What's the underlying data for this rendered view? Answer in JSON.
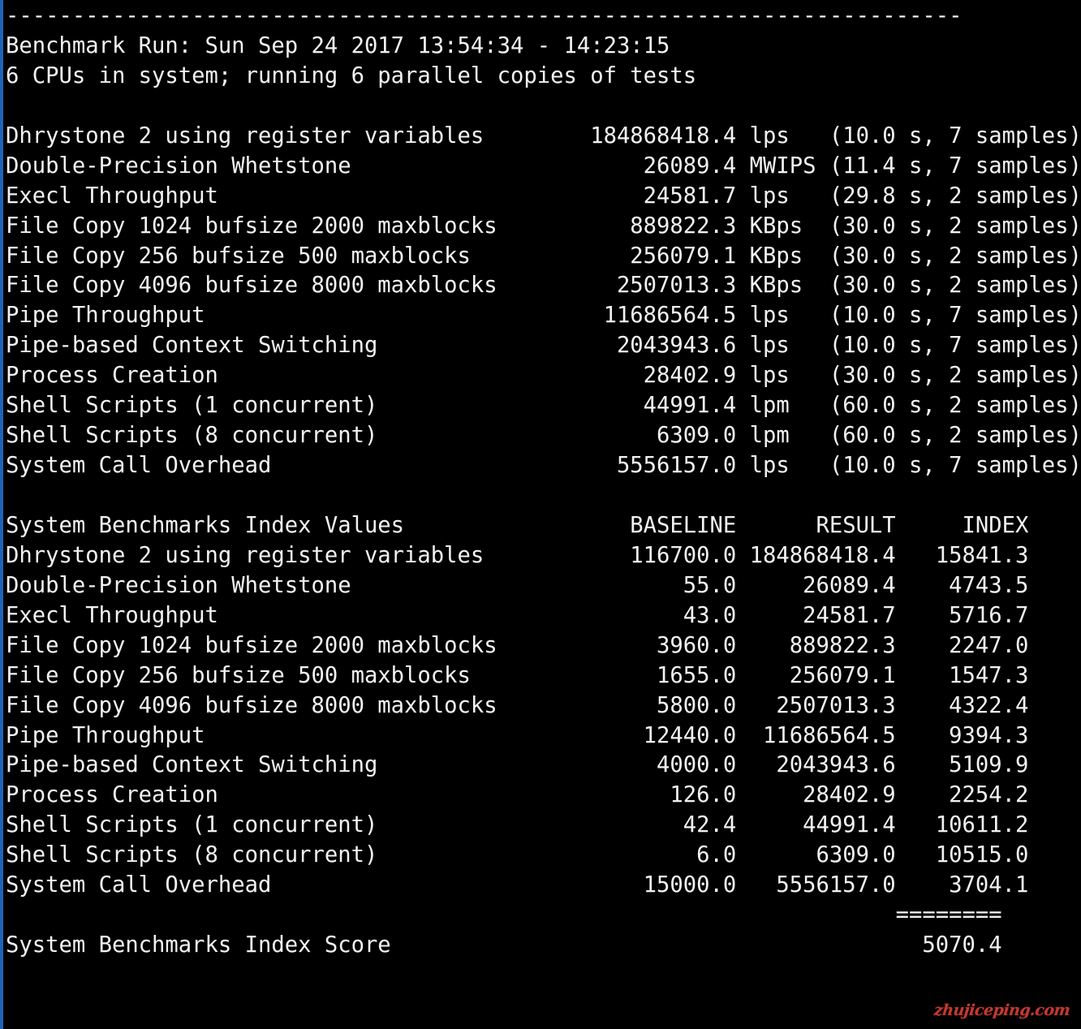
{
  "terminal": {
    "background_color": "#000000",
    "text_color": "#f2f2f2",
    "left_border_color": "#1f63b8",
    "separator_dashes": "------------------------------------------------------------------------",
    "header_run": "Benchmark Run: Sun Sep 24 2017 13:54:34 - 14:23:15",
    "header_cpus": "6 CPUs in system; running 6 parallel copies of tests"
  },
  "tests": {
    "rows": [
      {
        "name": "Dhrystone 2 using register variables",
        "value": "184868418.4",
        "unit": "lps",
        "timing": "(10.0 s, 7 samples)"
      },
      {
        "name": "Double-Precision Whetstone",
        "value": "26089.4",
        "unit": "MWIPS",
        "timing": "(11.4 s, 7 samples)"
      },
      {
        "name": "Execl Throughput",
        "value": "24581.7",
        "unit": "lps",
        "timing": "(29.8 s, 2 samples)"
      },
      {
        "name": "File Copy 1024 bufsize 2000 maxblocks",
        "value": "889822.3",
        "unit": "KBps",
        "timing": "(30.0 s, 2 samples)"
      },
      {
        "name": "File Copy 256 bufsize 500 maxblocks",
        "value": "256079.1",
        "unit": "KBps",
        "timing": "(30.0 s, 2 samples)"
      },
      {
        "name": "File Copy 4096 bufsize 8000 maxblocks",
        "value": "2507013.3",
        "unit": "KBps",
        "timing": "(30.0 s, 2 samples)"
      },
      {
        "name": "Pipe Throughput",
        "value": "11686564.5",
        "unit": "lps",
        "timing": "(10.0 s, 7 samples)"
      },
      {
        "name": "Pipe-based Context Switching",
        "value": "2043943.6",
        "unit": "lps",
        "timing": "(10.0 s, 7 samples)"
      },
      {
        "name": "Process Creation",
        "value": "28402.9",
        "unit": "lps",
        "timing": "(30.0 s, 2 samples)"
      },
      {
        "name": "Shell Scripts (1 concurrent)",
        "value": "44991.4",
        "unit": "lpm",
        "timing": "(60.0 s, 2 samples)"
      },
      {
        "name": "Shell Scripts (8 concurrent)",
        "value": "6309.0",
        "unit": "lpm",
        "timing": "(60.0 s, 2 samples)"
      },
      {
        "name": "System Call Overhead",
        "value": "5556157.0",
        "unit": "lps",
        "timing": "(10.0 s, 7 samples)"
      }
    ]
  },
  "index_table": {
    "title": "System Benchmarks Index Values",
    "columns": [
      "BASELINE",
      "RESULT",
      "INDEX"
    ],
    "rows": [
      {
        "name": "Dhrystone 2 using register variables",
        "baseline": "116700.0",
        "result": "184868418.4",
        "index": "15841.3"
      },
      {
        "name": "Double-Precision Whetstone",
        "baseline": "55.0",
        "result": "26089.4",
        "index": "4743.5"
      },
      {
        "name": "Execl Throughput",
        "baseline": "43.0",
        "result": "24581.7",
        "index": "5716.7"
      },
      {
        "name": "File Copy 1024 bufsize 2000 maxblocks",
        "baseline": "3960.0",
        "result": "889822.3",
        "index": "2247.0"
      },
      {
        "name": "File Copy 256 bufsize 500 maxblocks",
        "baseline": "1655.0",
        "result": "256079.1",
        "index": "1547.3"
      },
      {
        "name": "File Copy 4096 bufsize 8000 maxblocks",
        "baseline": "5800.0",
        "result": "2507013.3",
        "index": "4322.4"
      },
      {
        "name": "Pipe Throughput",
        "baseline": "12440.0",
        "result": "11686564.5",
        "index": "9394.3"
      },
      {
        "name": "Pipe-based Context Switching",
        "baseline": "4000.0",
        "result": "2043943.6",
        "index": "5109.9"
      },
      {
        "name": "Process Creation",
        "baseline": "126.0",
        "result": "28402.9",
        "index": "2254.2"
      },
      {
        "name": "Shell Scripts (1 concurrent)",
        "baseline": "42.4",
        "result": "44991.4",
        "index": "10611.2"
      },
      {
        "name": "Shell Scripts (8 concurrent)",
        "baseline": "6.0",
        "result": "6309.0",
        "index": "10515.0"
      },
      {
        "name": "System Call Overhead",
        "baseline": "15000.0",
        "result": "5556157.0",
        "index": "3704.1"
      }
    ],
    "score_rule": "========",
    "score_label": "System Benchmarks Index Score",
    "score_value": "5070.4"
  },
  "watermark": {
    "text": "zhujiceping.com",
    "color": "#c2392f"
  }
}
